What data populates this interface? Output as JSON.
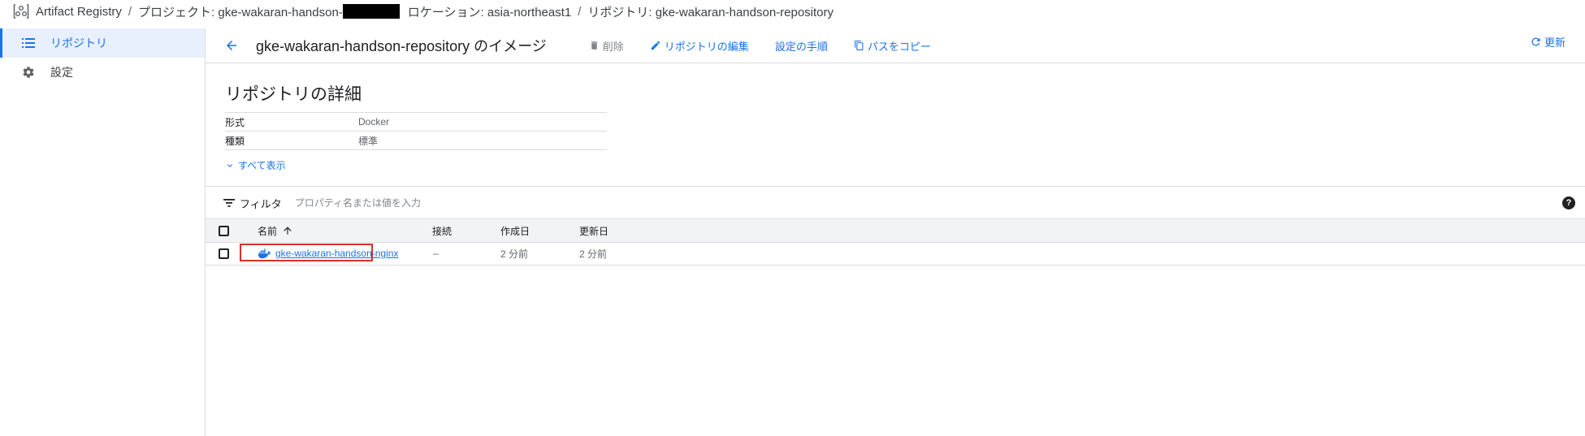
{
  "breadcrumb": {
    "product": "Artifact Registry",
    "separator": "/",
    "project": "プロジェクト: gke-wakaran-handson-",
    "location": "ロケーション: asia-northeast1",
    "repository": "リポジトリ: gke-wakaran-handson-repository"
  },
  "sidebar": {
    "items": [
      {
        "label": "リポジトリ",
        "icon": "list-icon",
        "active": true
      },
      {
        "label": "設定",
        "icon": "gear-icon",
        "active": false
      }
    ]
  },
  "toolbar": {
    "title": "gke-wakaran-handson-repository のイメージ",
    "delete_label": "削除",
    "edit_label": "リポジトリの編集",
    "setup_label": "設定の手順",
    "copy_path_label": "パスをコピー",
    "refresh_label": "更新"
  },
  "details": {
    "heading": "リポジトリの詳細",
    "rows": [
      {
        "key": "形式",
        "value": "Docker"
      },
      {
        "key": "種類",
        "value": "標準"
      }
    ],
    "show_all": "すべて表示"
  },
  "filter": {
    "label": "フィルタ",
    "placeholder": "プロパティ名または値を入力"
  },
  "table": {
    "headers": {
      "name": "名前",
      "connection": "接続",
      "created": "作成日",
      "updated": "更新日"
    },
    "rows": [
      {
        "name": "gke-wakaran-handson-nginx",
        "connection": "–",
        "created": "2 分前",
        "updated": "2 分前"
      }
    ]
  },
  "colors": {
    "accent": "#1a73e8",
    "highlight_border": "#d93025",
    "redaction": "#000000"
  }
}
